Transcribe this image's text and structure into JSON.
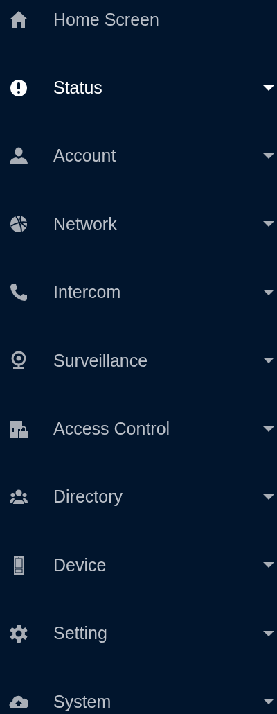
{
  "menu": [
    {
      "label": "Home Screen",
      "selected": false,
      "expandable": false
    },
    {
      "label": "Status",
      "selected": true,
      "expandable": true
    },
    {
      "label": "Account",
      "selected": false,
      "expandable": true
    },
    {
      "label": "Network",
      "selected": false,
      "expandable": true
    },
    {
      "label": "Intercom",
      "selected": false,
      "expandable": true
    },
    {
      "label": "Surveillance",
      "selected": false,
      "expandable": true
    },
    {
      "label": "Access Control",
      "selected": false,
      "expandable": true
    },
    {
      "label": "Directory",
      "selected": false,
      "expandable": true
    },
    {
      "label": "Device",
      "selected": false,
      "expandable": true
    },
    {
      "label": "Setting",
      "selected": false,
      "expandable": true
    },
    {
      "label": "System",
      "selected": false,
      "expandable": true
    }
  ]
}
